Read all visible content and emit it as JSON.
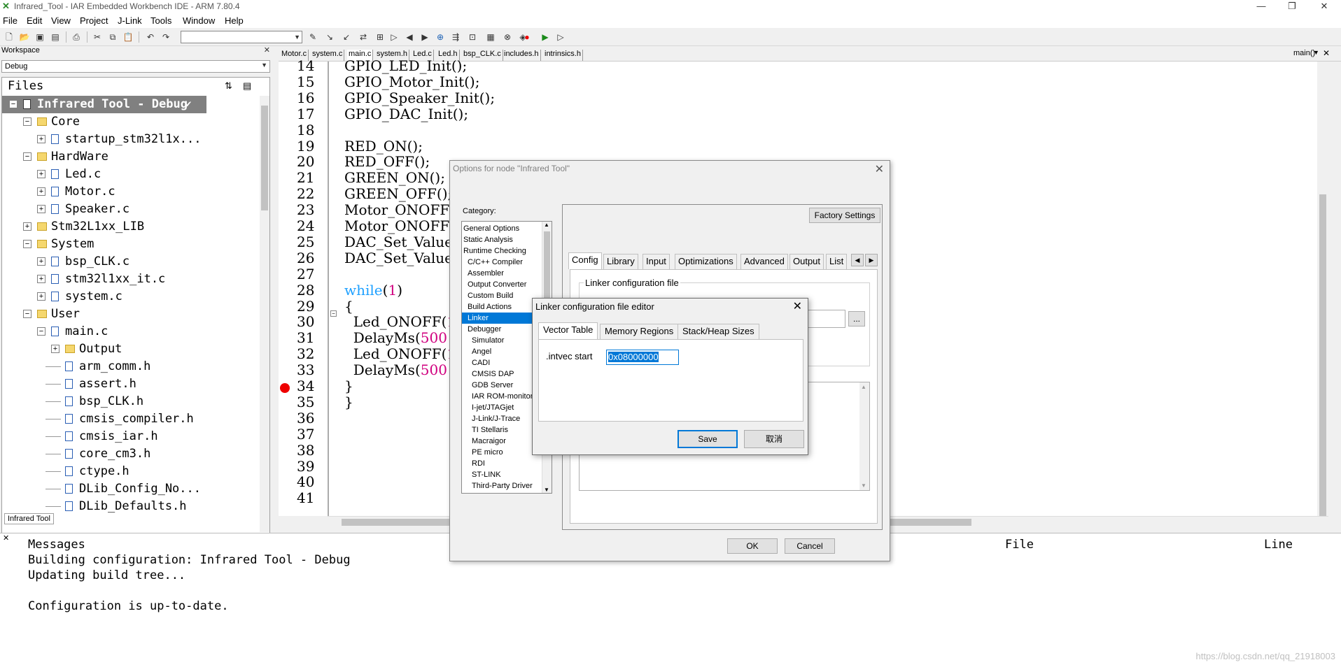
{
  "window": {
    "title": "Infrared_Tool - IAR Embedded Workbench IDE - ARM 7.80.4"
  },
  "menu": [
    "File",
    "Edit",
    "View",
    "Project",
    "J-Link",
    "Tools",
    "Window",
    "Help"
  ],
  "workspace": {
    "header": "Workspace",
    "config": "Debug",
    "files_label": "Files",
    "tab": "Infrared Tool",
    "tree": [
      {
        "label": "Infrared Tool - Debug",
        "level": 0,
        "type": "project",
        "expanded": true
      },
      {
        "label": "Core",
        "level": 1,
        "type": "folder",
        "expanded": true
      },
      {
        "label": "startup_stm32l1x...",
        "level": 2,
        "type": "file",
        "expanded": false
      },
      {
        "label": "HardWare",
        "level": 1,
        "type": "folder",
        "expanded": true
      },
      {
        "label": "Led.c",
        "level": 2,
        "type": "file",
        "expanded": false
      },
      {
        "label": "Motor.c",
        "level": 2,
        "type": "file",
        "expanded": false
      },
      {
        "label": "Speaker.c",
        "level": 2,
        "type": "file",
        "expanded": false
      },
      {
        "label": "Stm32L1xx_LIB",
        "level": 1,
        "type": "folder",
        "expanded": false
      },
      {
        "label": "System",
        "level": 1,
        "type": "folder",
        "expanded": true
      },
      {
        "label": "bsp_CLK.c",
        "level": 2,
        "type": "file",
        "expanded": false
      },
      {
        "label": "stm32l1xx_it.c",
        "level": 2,
        "type": "file",
        "expanded": false
      },
      {
        "label": "system.c",
        "level": 2,
        "type": "file",
        "expanded": false
      },
      {
        "label": "User",
        "level": 1,
        "type": "folder",
        "expanded": true
      },
      {
        "label": "main.c",
        "level": 2,
        "type": "file",
        "expanded": true
      },
      {
        "label": "Output",
        "level": 3,
        "type": "folder",
        "expanded": false
      },
      {
        "label": "arm_comm.h",
        "level": 3,
        "type": "header"
      },
      {
        "label": "assert.h",
        "level": 3,
        "type": "header"
      },
      {
        "label": "bsp_CLK.h",
        "level": 3,
        "type": "header"
      },
      {
        "label": "cmsis_compiler.h",
        "level": 3,
        "type": "header"
      },
      {
        "label": "cmsis_iar.h",
        "level": 3,
        "type": "header"
      },
      {
        "label": "core_cm3.h",
        "level": 3,
        "type": "header"
      },
      {
        "label": "ctype.h",
        "level": 3,
        "type": "header"
      },
      {
        "label": "DLib_Config_No...",
        "level": 3,
        "type": "header"
      },
      {
        "label": "DLib_Defaults.h",
        "level": 3,
        "type": "header"
      }
    ]
  },
  "editor": {
    "tabs": [
      "Motor.c",
      "system.c",
      "main.c",
      "system.h",
      "Led.c",
      "Led.h",
      "bsp_CLK.c",
      "includes.h",
      "intrinsics.h"
    ],
    "active_tab": "main.c",
    "function_selector": "main()",
    "lines": [
      {
        "n": "14",
        "text": "GPIO_LED_Init();"
      },
      {
        "n": "15",
        "text": "GPIO_Motor_Init();"
      },
      {
        "n": "16",
        "text": "GPIO_Speaker_Init();"
      },
      {
        "n": "17",
        "text": "GPIO_DAC_Init();"
      },
      {
        "n": "18",
        "text": ""
      },
      {
        "n": "19",
        "text": "RED_ON();"
      },
      {
        "n": "20",
        "text": "RED_OFF();"
      },
      {
        "n": "21",
        "text": "GREEN_ON();"
      },
      {
        "n": "22",
        "text": "GREEN_OFF();"
      },
      {
        "n": "23",
        "text": "Motor_ONOFF("
      },
      {
        "n": "24",
        "text": "Motor_ONOFF(0"
      },
      {
        "n": "25",
        "text": "DAC_Set_Value"
      },
      {
        "n": "26",
        "text": "DAC_Set_Value"
      },
      {
        "n": "27",
        "text": ""
      },
      {
        "n": "28",
        "text": "while(1)"
      },
      {
        "n": "29",
        "text": "{"
      },
      {
        "n": "30",
        "text": "  Led_ONOFF(1"
      },
      {
        "n": "31",
        "text": "  DelayMs(500"
      },
      {
        "n": "32",
        "text": "  Led_ONOFF(1"
      },
      {
        "n": "33",
        "text": "  DelayMs(500"
      },
      {
        "n": "34",
        "text": "}"
      },
      {
        "n": "35",
        "text": "}"
      },
      {
        "n": "36",
        "text": ""
      },
      {
        "n": "37",
        "text": ""
      },
      {
        "n": "38",
        "text": ""
      },
      {
        "n": "39",
        "text": ""
      },
      {
        "n": "40",
        "text": ""
      },
      {
        "n": "41",
        "text": ""
      }
    ]
  },
  "messages": {
    "col_messages": "Messages",
    "col_file": "File",
    "col_line": "Line",
    "lines": [
      "Building configuration: Infrared Tool - Debug",
      "Updating build tree...",
      "",
      "Configuration is up-to-date."
    ],
    "watermark": "https://blog.csdn.net/qq_21918003"
  },
  "options_dialog": {
    "title": "Options for node \"Infrared Tool\"",
    "category_label": "Category:",
    "categories": [
      {
        "label": "General Options",
        "indent": 0
      },
      {
        "label": "Static Analysis",
        "indent": 0
      },
      {
        "label": "Runtime Checking",
        "indent": 0
      },
      {
        "label": "C/C++ Compiler",
        "indent": 1
      },
      {
        "label": "Assembler",
        "indent": 1
      },
      {
        "label": "Output Converter",
        "indent": 1
      },
      {
        "label": "Custom Build",
        "indent": 1
      },
      {
        "label": "Build Actions",
        "indent": 1
      },
      {
        "label": "Linker",
        "indent": 1
      },
      {
        "label": "Debugger",
        "indent": 1
      },
      {
        "label": "Simulator",
        "indent": 2
      },
      {
        "label": "Angel",
        "indent": 2
      },
      {
        "label": "CADI",
        "indent": 2
      },
      {
        "label": "CMSIS DAP",
        "indent": 2
      },
      {
        "label": "GDB Server",
        "indent": 2
      },
      {
        "label": "IAR ROM-monitor",
        "indent": 2
      },
      {
        "label": "I-jet/JTAGjet",
        "indent": 2
      },
      {
        "label": "J-Link/J-Trace",
        "indent": 2
      },
      {
        "label": "TI Stellaris",
        "indent": 2
      },
      {
        "label": "Macraigor",
        "indent": 2
      },
      {
        "label": "PE micro",
        "indent": 2
      },
      {
        "label": "RDI",
        "indent": 2
      },
      {
        "label": "ST-LINK",
        "indent": 2
      },
      {
        "label": "Third-Party Driver",
        "indent": 2
      }
    ],
    "selected_category": "Linker",
    "factory_settings": "Factory Settings",
    "tabs": [
      "Config",
      "Library",
      "Input",
      "Optimizations",
      "Advanced",
      "Output",
      "List"
    ],
    "active_tab": "Config",
    "group_label": "Linker configuration file",
    "browse_label": "...",
    "ok": "OK",
    "cancel": "Cancel"
  },
  "linker_editor": {
    "title": "Linker configuration file editor",
    "tabs": [
      "Vector Table",
      "Memory Regions",
      "Stack/Heap Sizes"
    ],
    "active_tab": "Vector Table",
    "field_label": ".intvec start",
    "field_value": "0x08000000",
    "save": "Save",
    "cancel": "取消"
  },
  "colors": {
    "selection": "#0078d7",
    "keyword": "#1ea0ff",
    "number": "#d0007f",
    "breakpoint": "#ee0000",
    "editor_bg": "#ababab"
  }
}
